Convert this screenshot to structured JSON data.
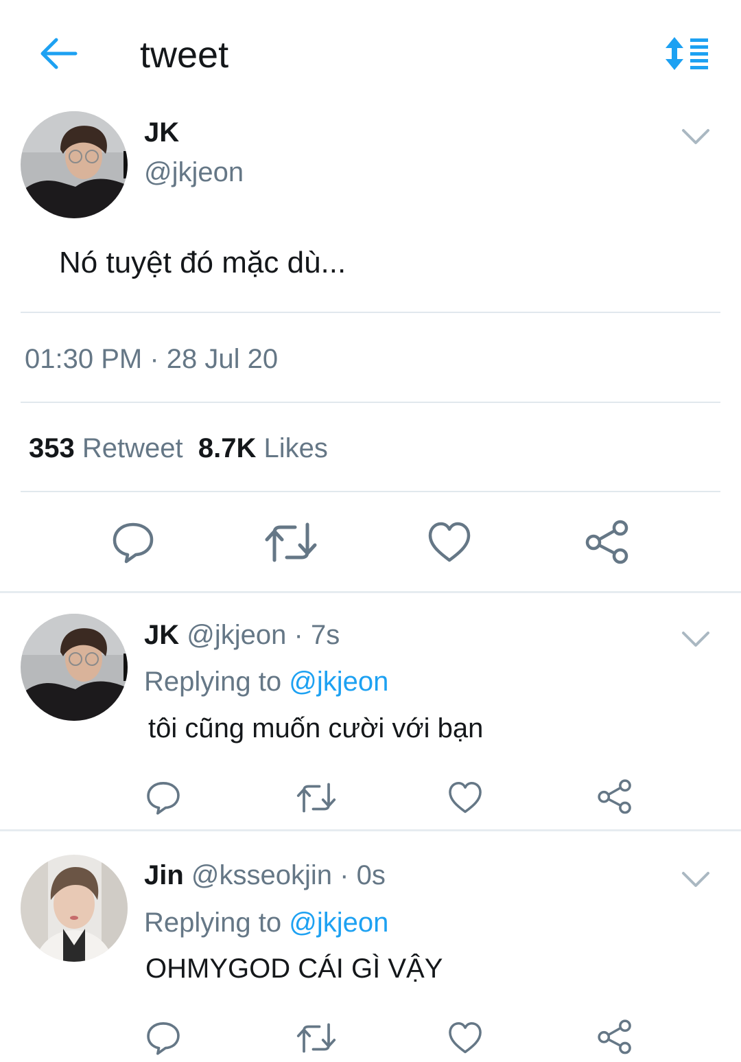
{
  "header": {
    "title": "tweet",
    "back_icon": "arrow-left-icon",
    "sort_icon": "sort-list-icon",
    "accent_color": "#1da1f2"
  },
  "main_tweet": {
    "name": "JK",
    "handle": "@jkjeon",
    "text": "Nó tuyệt đó mặc dù...",
    "timestamp": "01:30 PM · 28 Jul 20",
    "retweet_count": "353",
    "retweet_label": "Retweet",
    "likes_count": "8.7K",
    "likes_label": "Likes",
    "actions": [
      "reply-icon",
      "retweet-icon",
      "like-icon",
      "share-icon"
    ]
  },
  "replies": [
    {
      "name": "JK",
      "handle": "@jkjeon",
      "time": "· 7s",
      "replying_prefix": "Replying to",
      "replying_handle": "@jkjeon",
      "text": "tôi cũng muốn cười với bạn"
    },
    {
      "name": "Jin",
      "handle": "@ksseokjin",
      "time": "· 0s",
      "replying_prefix": "Replying to",
      "replying_handle": "@jkjeon",
      "text": "OHMYGOD CÁI GÌ VẬY"
    }
  ],
  "colors": {
    "text": "#14171a",
    "muted": "#657786",
    "link": "#1da1f2",
    "divider": "#e1e8ed"
  }
}
